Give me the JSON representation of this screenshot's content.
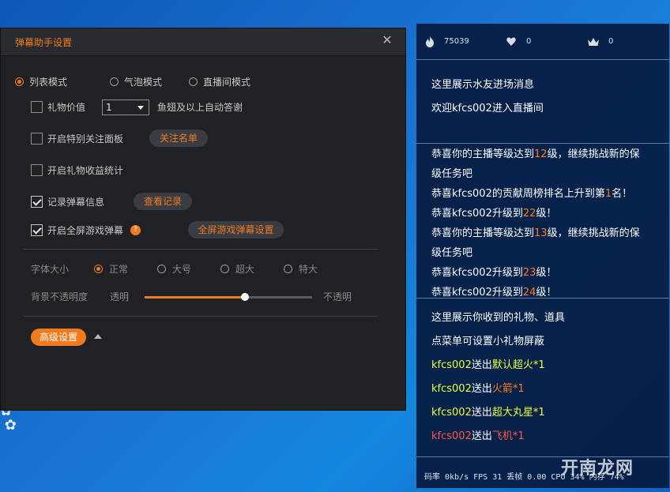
{
  "settings": {
    "title": "弹幕助手设置",
    "mode_options": [
      "列表模式",
      "气泡模式",
      "直播间模式"
    ],
    "gift_value_label": "礼物价值",
    "gift_value_selected": "1",
    "auto_thanks_label": "鱼翅及以上自动答谢",
    "special_follow_label": "开启特别关注面板",
    "follow_list_button": "关注名单",
    "gift_income_label": "开启礼物收益统计",
    "record_barrage_label": "记录弹幕信息",
    "view_record_button": "查看记录",
    "fullscreen_game_label": "开启全屏游戏弹幕",
    "help_badge": "?",
    "fullscreen_settings_button": "全屏游戏弹幕设置",
    "font_size_label": "字体大小",
    "font_size_options": [
      "正常",
      "大号",
      "超大",
      "特大"
    ],
    "opacity_label": "背景不透明度",
    "opacity_min_label": "透明",
    "opacity_max_label": "不透明",
    "opacity_value": 0.6,
    "advanced_button": "高级设置",
    "accent_color": "#f07b1f"
  },
  "panel": {
    "stats": {
      "hot": "75039",
      "likes": "0",
      "fans": "0"
    },
    "entrance": {
      "line1": "这里展示水友进场消息",
      "line2": "欢迎kfcs002进入直播间"
    },
    "level": {
      "l1_a": "恭喜你的主播等级达到",
      "l1_num": "12",
      "l1_b": "级，继续挑战新的保",
      "l1_c": "级任务吧",
      "l2_a": "恭喜kfcs002的贡献周榜排名上升到第",
      "l2_num": "1",
      "l2_b": "名！",
      "l3_a": "恭喜kfcs002升级到",
      "l3_num": "22",
      "l3_b": "级！",
      "l4_a": "恭喜你的主播等级达到",
      "l4_num": "13",
      "l4_b": "级，继续挑战新的保",
      "l4_c": "级任务吧",
      "l5_a": "恭喜kfcs002升级到",
      "l5_num": "23",
      "l5_b": "级！",
      "l6_a": "恭喜kfcs002升级到",
      "l6_num": "24",
      "l6_b": "级！"
    },
    "gifts": {
      "info1": "这里展示你收到的礼物、道具",
      "info2": "点菜单可设置小礼物屏蔽",
      "g1_user": "kfcs002",
      "g1_verb": "送出",
      "g1_item": "默认超火*1",
      "g2_user": "kfcs002",
      "g2_verb": "送出",
      "g2_item": "火箭*1",
      "g3_user": "kfcs002",
      "g3_verb": "送出",
      "g3_item": "超大丸星*1",
      "g4_user": "kfcs002",
      "g4_verb": "送出",
      "g4_item": "飞机*1"
    },
    "footer": "码率 0kb/s FPS 31 丢帧 0.00   CPU 34% 内存 74%",
    "watermark": "开南龙网"
  }
}
